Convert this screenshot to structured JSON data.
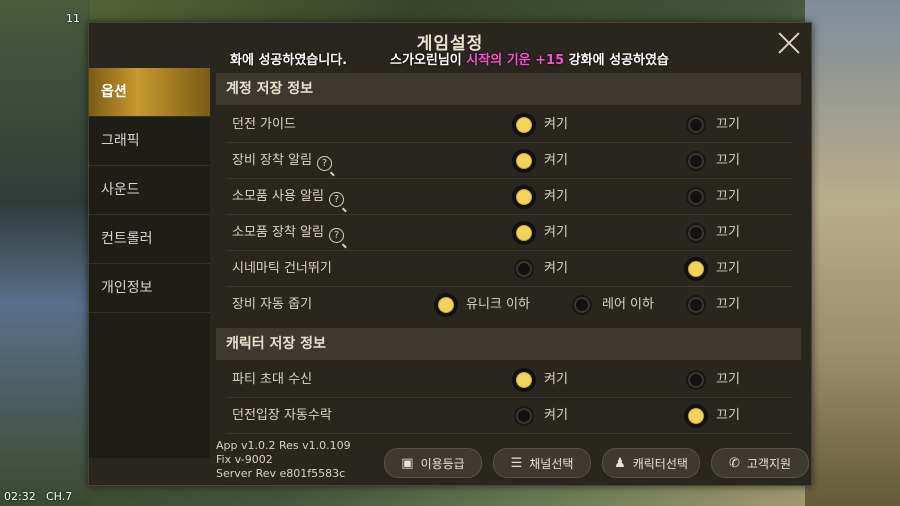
{
  "hud": {
    "time": "02:32",
    "channel": "CH.7",
    "level_badge": "11"
  },
  "modal": {
    "title": "게임설정"
  },
  "notice": {
    "part1": "화에 성공하였습니다.",
    "part2_pre": "스가오린님이 ",
    "part2_item": "시작의 기운 +15",
    "part2_post": " 강화에 성공하였습"
  },
  "sidebar": {
    "items": [
      {
        "label": "옵션",
        "active": true
      },
      {
        "label": "그래픽"
      },
      {
        "label": "사운드"
      },
      {
        "label": "컨트롤러"
      },
      {
        "label": "개인정보"
      }
    ]
  },
  "sections": {
    "account": {
      "title": "계정 저장 정보",
      "rows": [
        {
          "label": "던전 가이드",
          "on": "켜기",
          "off": "끄기",
          "selected": "on"
        },
        {
          "label": "장비 장착 알림",
          "help": true,
          "on": "켜기",
          "off": "끄기",
          "selected": "on"
        },
        {
          "label": "소모품 사용 알림",
          "help": true,
          "on": "켜기",
          "off": "끄기",
          "selected": "on"
        },
        {
          "label": "소모품 장착 알림",
          "help": true,
          "on": "켜기",
          "off": "끄기",
          "selected": "on"
        },
        {
          "label": "시네마틱 건너뛰기",
          "on": "켜기",
          "off": "끄기",
          "selected": "off"
        }
      ],
      "auto_dismantle": {
        "label": "장비 자동 줍기",
        "opt1": "유니크 이하",
        "opt2": "레어 이하",
        "opt3": "끄기",
        "selected": "opt1"
      }
    },
    "character": {
      "title": "캐릭터 저장 정보",
      "rows": [
        {
          "label": "파티 초대 수신",
          "on": "켜기",
          "off": "끄기",
          "selected": "on"
        },
        {
          "label": "던전입장 자동수락",
          "on": "켜기",
          "off": "끄기",
          "selected": "off"
        }
      ]
    }
  },
  "footer": {
    "version_line1": "App v1.0.2 Res v1.0.109",
    "version_line2": "Fix v-9002",
    "version_line3": "Server Rev e801f5583c",
    "buttons": {
      "rating": "이용등급",
      "channel": "채널선택",
      "character": "캐릭터선택",
      "support": "고객지원"
    }
  },
  "colors": {
    "radio_on": "#f3d35a",
    "highlight": "#ff4fd1",
    "active_tab": "#c79a2e"
  }
}
